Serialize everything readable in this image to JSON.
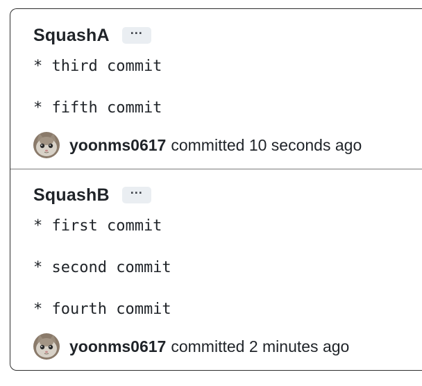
{
  "commits": [
    {
      "title": "SquashA",
      "more_label": "···",
      "messages": [
        "* third commit",
        "* fifth commit"
      ],
      "author": "yoonms0617",
      "committed": "committed 10 seconds ago"
    },
    {
      "title": "SquashB",
      "more_label": "···",
      "messages": [
        "* first commit",
        "* second commit",
        "* fourth commit"
      ],
      "author": "yoonms0617",
      "committed": "committed 2 minutes ago"
    }
  ],
  "icons": {
    "more": "ellipsis-icon",
    "avatar": "cat-avatar-icon"
  },
  "colors": {
    "text": "#1f2328",
    "button_bg": "#eaeef2",
    "border": "#2d2d2d"
  }
}
